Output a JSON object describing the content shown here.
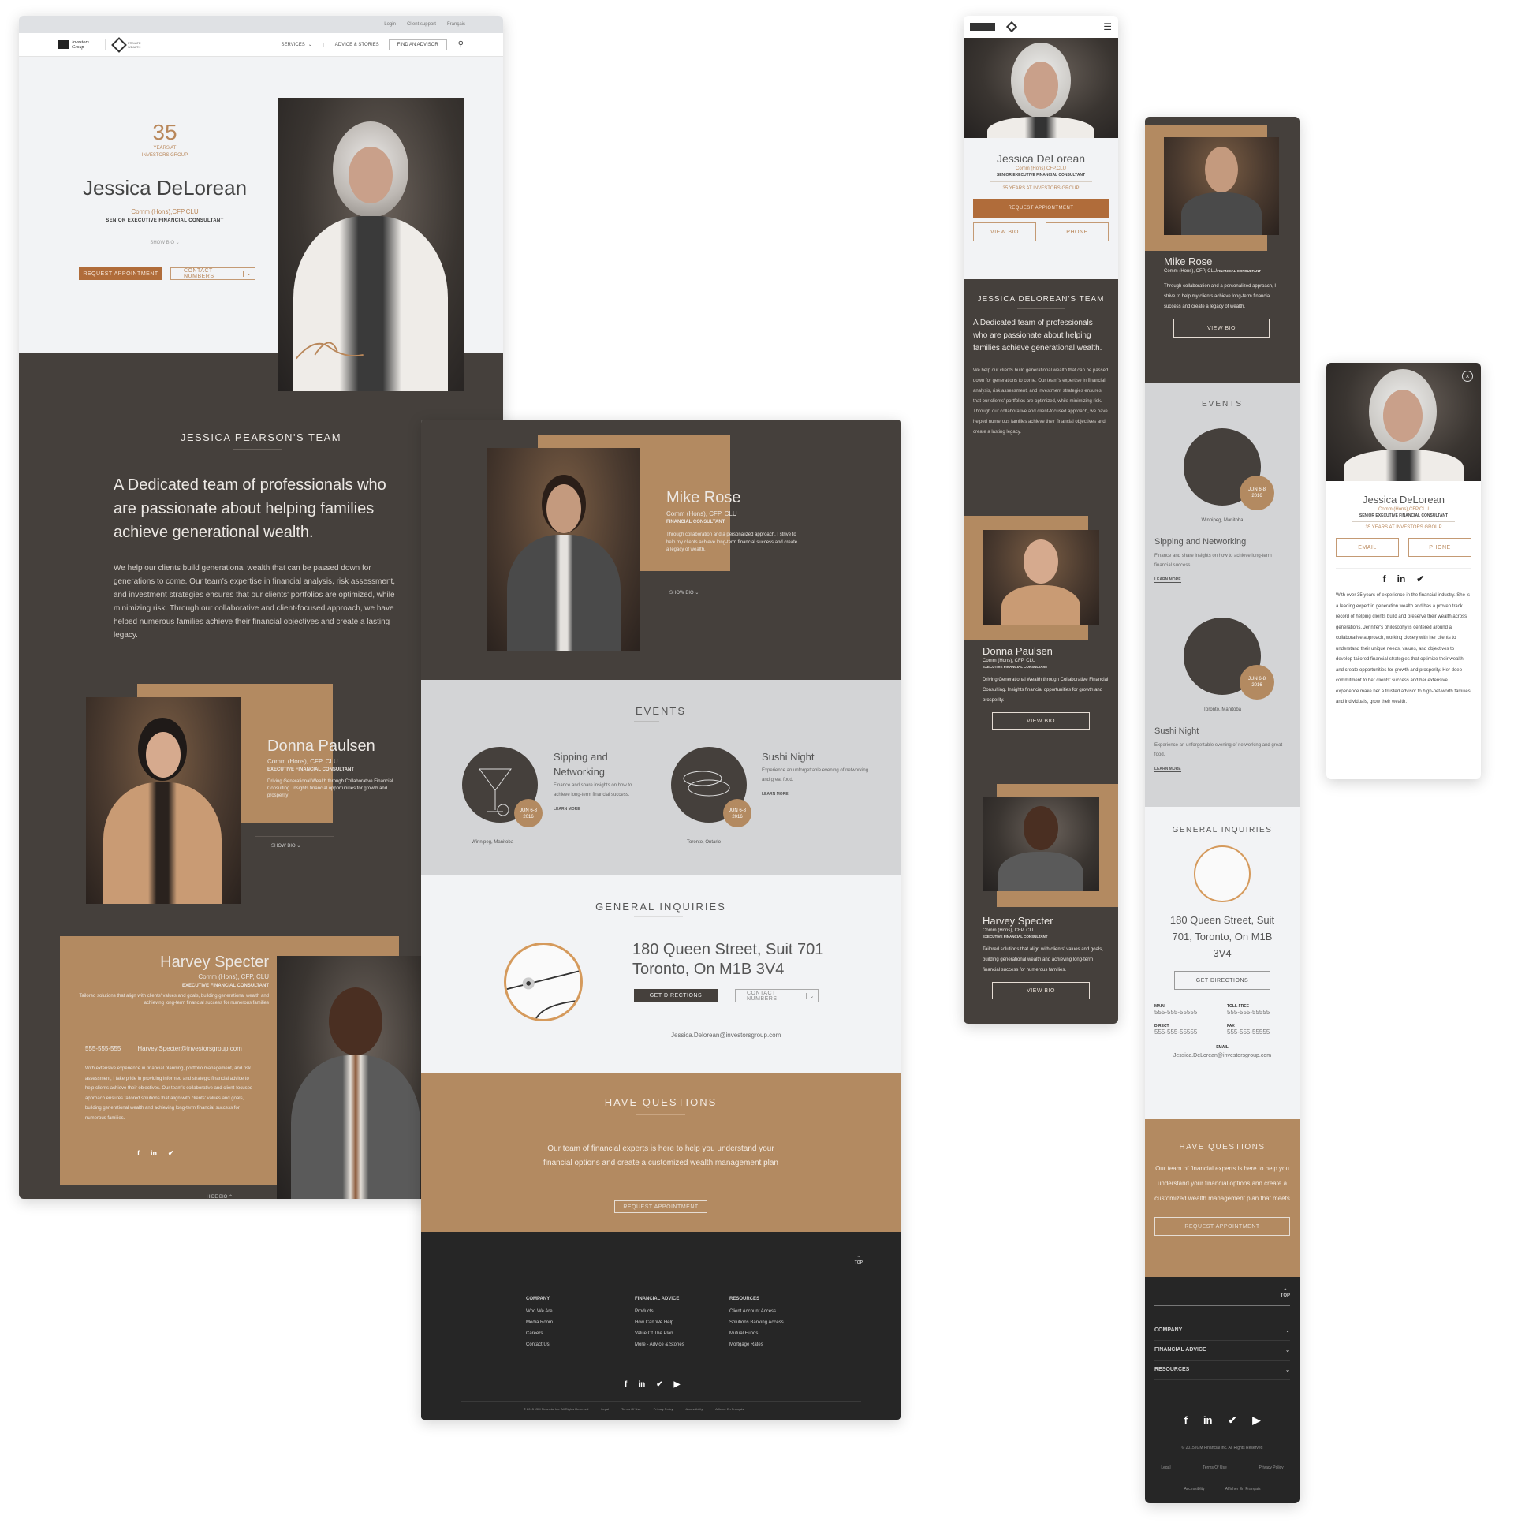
{
  "colors": {
    "accent": "#b9875a",
    "tan": "#b38a61",
    "dark": "#45403c",
    "footer": "#262626",
    "button": "#b06c3a"
  },
  "desktop": {
    "utility": {
      "login": "Login",
      "client_support": "Client support",
      "language": "Français"
    },
    "nav": {
      "logo1": "Investors Group",
      "logo2_line1": "PRIVATE",
      "logo2_line2": "WEALTH",
      "logo2_line3": "MANAGEMENT",
      "services": "SERVICES",
      "advice": "ADVICE & STORIES",
      "find": "FIND AN ADVISOR"
    },
    "hero": {
      "years": "35",
      "years_label1": "YEARS AT",
      "years_label2": "INVESTORS GROUP",
      "name": "Jessica DeLorean",
      "credentials": "Comm (Hons),CFP,CLU",
      "title": "SENIOR EXECUTIVE FINANCIAL CONSULTANT",
      "show_bio": "SHOW BIO",
      "request": "REQUEST APPOINTMENT",
      "contact": "CONTACT NUMBERS"
    },
    "team": {
      "heading": "JESSICA PEARSON'S TEAM",
      "lead": "A Dedicated team of professionals who are passionate about helping families achieve generational wealth.",
      "body": "We help our clients build generational wealth that can be passed down for generations to come. Our team's expertise in financial analysis, risk assessment, and investment strategies ensures that our clients' portfolios are optimized, while minimizing risk. Through our collaborative and client-focused approach, we have helped numerous families achieve their financial objectives and create a lasting legacy."
    },
    "donna": {
      "name": "Donna Paulsen",
      "credentials": "Comm (Hons), CFP, CLU",
      "title": "EXECUTIVE FINANCIAL CONSULTANT",
      "desc": "Driving Generational Wealth through Collaborative Financial Consulting. Insights financial opportunities for growth and prosperity",
      "show_bio": "SHOW BIO"
    },
    "harvey": {
      "name": "Harvey Specter",
      "credentials": "Comm (Hons), CFP, CLU",
      "title": "EXECUTIVE FINANCIAL CONSULTANT",
      "desc": "Tailored solutions that align with clients' values and goals, building generational wealth and achieving long-term financial success for numerous families",
      "phone": "555-555-555",
      "email": "Harvey.Specter@investorsgroup.com",
      "bio": "With extensive experience in financial planning, portfolio management, and risk assessment, I take pride in providing informed and strategic financial advice to help clients achieve their objectives. Our team's collaborative and client-focused approach ensures tailored solutions that align with clients' values and goals, building generational wealth and achieving long-term financial success for numerous families.",
      "hide_bio": "HIDE BIO"
    }
  },
  "tablet": {
    "mike": {
      "name": "Mike Rose",
      "credentials": "Comm (Hons), CFP, CLU",
      "title": "FINANCIAL CONSULTANT",
      "desc": "Through collaboration and a personalized approach, I strive to help my clients achieve long-term financial success and create a legacy of wealth.",
      "show_bio": "SHOW BIO"
    },
    "events": {
      "heading": "EVENTS",
      "items": [
        {
          "title": "Sipping and Networking",
          "desc": "Finance and share insights on how to achieve long-term financial success.",
          "date1": "JUN 6-8",
          "date2": "2016",
          "location": "Winnipeg, Manitoba",
          "learn": "LEARN MORE",
          "icon": "martini-icon"
        },
        {
          "title": "Sushi Night",
          "desc": "Experience an unforgettable evening of networking and great food.",
          "date1": "JUN 6-8",
          "date2": "2016",
          "location": "Toronto, Ontario",
          "learn": "LEARN MORE",
          "icon": "sushi-icon"
        }
      ]
    },
    "inquiries": {
      "heading": "GENERAL INQUIRIES",
      "addr1": "180 Queen Street, Suit 701",
      "addr2": "Toronto, On M1B 3V4",
      "directions": "GET DIRECTIONS",
      "contact": "CONTACT NUMBERS",
      "email": "Jessica.Delorean@investorsgroup.com"
    },
    "questions": {
      "heading": "HAVE QUESTIONS",
      "body": "Our team of financial experts is here to help you understand your financial options and create a customized wealth management plan",
      "button": "REQUEST APPOINTMENT"
    },
    "footer": {
      "top": "TOP",
      "columns": [
        {
          "heading": "COMPANY",
          "links": [
            "Who We Are",
            "Media Room",
            "Careers",
            "Contact Us"
          ]
        },
        {
          "heading": "FINANCIAL ADVICE",
          "links": [
            "Products",
            "How Can We Help",
            "Value Of The Plan",
            "More - Advice & Stories"
          ]
        },
        {
          "heading": "RESOURCES",
          "links": [
            "Client Account Access",
            "Solutions Banking Access",
            "Mutual Funds",
            "Mortgage Rates"
          ]
        }
      ],
      "legal": [
        "© 2015 IGM Financial Inc. All Rights Reserved",
        "Legal",
        "Terms Of Use",
        "Privacy Policy",
        "Accessibility",
        "Afficher En Français"
      ]
    }
  },
  "mobile1": {
    "name": "Jessica DeLorean",
    "credentials": "Comm (Hons),CFP,CLU",
    "title": "SENIOR EXECUTIVE FINANCIAL CONSULTANT",
    "years": "35 YEARS AT INVESTORS GROUP",
    "request": "REQUEST APPIONTMENT",
    "view_bio": "VIEW BIO",
    "phone": "PHONE",
    "team_heading": "JESSICA DELOREAN'S TEAM",
    "team_lead": "A Dedicated team of professionals who are passionate about helping families achieve generational wealth.",
    "team_body": "We help our clients build generational wealth that can be passed down for generations to come. Our team's expertise in financial analysis, risk assessment, and investment strategies ensures that our clients' portfolios are optimized, while minimizing risk. Through our collaborative and client-focused approach, we have helped numerous families achieve their financial objectives and create a lasting legacy.",
    "donna": {
      "name": "Donna Paulsen",
      "credentials": "Comm (Hons), CFP, CLU",
      "title": "EXECUTIVE FINANCIAL CONSULTANT",
      "desc": "Driving Generational Wealth through Collaborative Financial Consulting. Insights financial opportunities for growth and prosperity.",
      "view": "VIEW BIO"
    },
    "harvey": {
      "name": "Harvey Specter",
      "credentials": "Comm (Hons), CFP, CLU",
      "title": "EXECUTIVE FINANCIAL CONSULTANT",
      "desc": "Tailored solutions that align with clients' values and goals, building generational wealth and achieving long-term financial success for numerous families.",
      "view": "VIEW BIO"
    }
  },
  "mobile2": {
    "mike": {
      "name": "Mike Rose",
      "credentials": "Comm (Hons), CFP, CLU",
      "title": "FINANCIAL CONSULTANT",
      "desc": "Through collaboration and a personalized approach, I strive to help my clients achieve long-term financial success and create a legacy of wealth.",
      "view": "VIEW BIO"
    },
    "events_heading": "EVENTS",
    "events": [
      {
        "title": "Sipping and Networking",
        "desc": "Finance and share insights on how to achieve long-term financial success.",
        "date1": "JUN 6-8",
        "date2": "2016",
        "location": "Winnipeg, Manitoba",
        "learn": "LEARN MORE"
      },
      {
        "title": "Sushi Night",
        "desc": "Experience an unforgettable evening of networking and great food.",
        "date1": "JUN 6-8",
        "date2": "2016",
        "location": "Toronto, Manitoba",
        "learn": "LEARN MORE"
      }
    ],
    "inquiries_heading": "GENERAL INQUIRIES",
    "address": "180 Queen Street, Suit 701, Toronto, On M1B 3V4",
    "directions": "GET DIRECTIONS",
    "phones": [
      {
        "label": "MAIN",
        "value": "555-555-55555"
      },
      {
        "label": "TOLL-FREE",
        "value": "555-555-55555"
      },
      {
        "label": "DIRECT",
        "value": "555-555-55555"
      },
      {
        "label": "FAX",
        "value": "555-555-55555"
      }
    ],
    "email_label": "EMAIL",
    "email": "Jessica.DeLorean@investorsgroup.com",
    "questions_heading": "HAVE QUESTIONS",
    "questions_body": "Our team of financial experts is here to help you understand your financial options and create a customized wealth management plan that meets",
    "questions_button": "REQUEST APPOINTMENT",
    "top": "TOP",
    "accordion": [
      "COMPANY",
      "FINANCIAL ADVICE",
      "RESOURCES"
    ],
    "copyright": "© 2015 IGM Financial Inc. All Rights Reserved",
    "links1": [
      "Legal",
      "Terms Of Use",
      "Privacy Policy"
    ],
    "links2": [
      "Accessiblity",
      "Afficher En Français"
    ]
  },
  "modal": {
    "name": "Jessica DeLorean",
    "credentials": "Comm (Hons),CFP,CLU",
    "title": "SENIOR EXECUTIVE FINANCIAL CONSULTANT",
    "years": "35 YEARS AT INVESTORS GROUP",
    "email": "EMAIL",
    "phone": "PHONE",
    "bio": "With over 35 years of experience in the financial industry. She is a leading expert in generation wealth and has a proven track record of helping clients build and preserve their wealth across generations. Jennifer's philosophy is centered around a collaborative approach, working closely with her clients to understand their unique needs, values, and objectives to develop tailored financial strategies that optimize their wealth and create opportunities for growth and prosperity. Her deep commitment to her clients' success and her extensive experience make her a trusted advisor to high-net-worth families and individuals, grow their wealth."
  }
}
